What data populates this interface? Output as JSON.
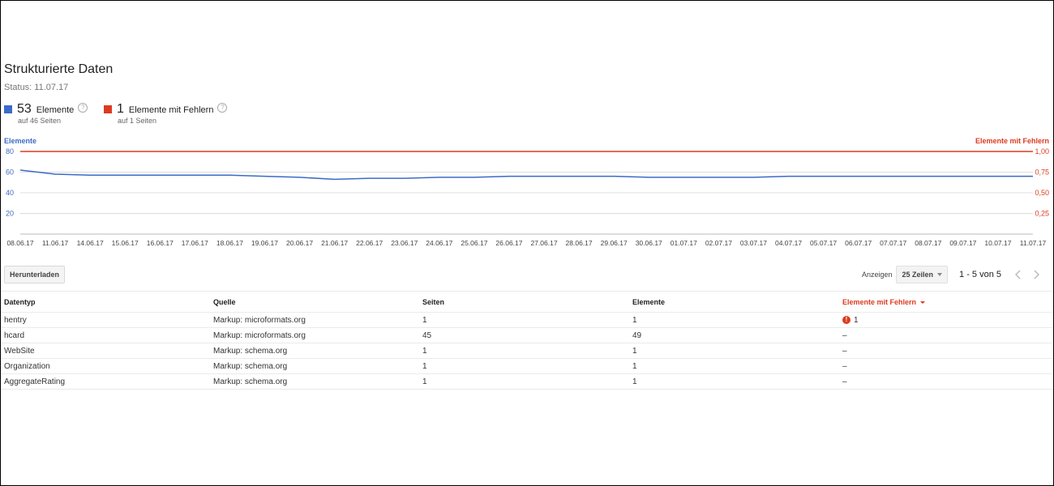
{
  "page": {
    "title": "Strukturierte Daten",
    "status": "Status: 11.07.17"
  },
  "summary": {
    "items": {
      "count": "53",
      "label": "Elemente",
      "sub": "auf 46 Seiten",
      "color": "#3c6bc8"
    },
    "errors": {
      "count": "1",
      "label": "Elemente mit Fehlern",
      "sub": "auf 1 Seiten",
      "color": "#dd3b1f"
    },
    "help_icon": "help-circle-icon"
  },
  "chart_data": {
    "type": "line",
    "x": [
      "08.06.17",
      "11.06.17",
      "14.06.17",
      "15.06.17",
      "16.06.17",
      "17.06.17",
      "18.06.17",
      "19.06.17",
      "20.06.17",
      "21.06.17",
      "22.06.17",
      "23.06.17",
      "24.06.17",
      "25.06.17",
      "26.06.17",
      "27.06.17",
      "28.06.17",
      "29.06.17",
      "30.06.17",
      "01.07.17",
      "02.07.17",
      "03.07.17",
      "04.07.17",
      "05.07.17",
      "06.07.17",
      "07.07.17",
      "08.07.17",
      "09.07.17",
      "10.07.17",
      "11.07.17"
    ],
    "series": [
      {
        "name": "Elemente",
        "axis": "left",
        "color": "#3c6bc8",
        "values": [
          62,
          58,
          57,
          57,
          57,
          57,
          57,
          56,
          55,
          53,
          54,
          54,
          55,
          55,
          56,
          56,
          56,
          56,
          55,
          55,
          55,
          55,
          56,
          56,
          56,
          56,
          56,
          56,
          56,
          56
        ]
      },
      {
        "name": "Elemente mit Fehlern",
        "axis": "right",
        "color": "#dd3b1f",
        "values": [
          1,
          1,
          1,
          1,
          1,
          1,
          1,
          1,
          1,
          1,
          1,
          1,
          1,
          1,
          1,
          1,
          1,
          1,
          1,
          1,
          1,
          1,
          1,
          1,
          1,
          1,
          1,
          1,
          1,
          1
        ]
      }
    ],
    "ylabel": "Elemente",
    "ylabel_right": "Elemente mit Fehlern",
    "yticks_left": [
      "80",
      "60",
      "40",
      "20"
    ],
    "yticks_right": [
      "1,00",
      "0,75",
      "0,50",
      "0,25"
    ],
    "ylim": [
      0,
      80
    ],
    "ylim_right": [
      0,
      1
    ],
    "grid": true
  },
  "toolbar": {
    "download_label": "Herunterladen",
    "show_label": "Anzeigen",
    "rows_value": "25 Zeilen",
    "range": "1 - 5 von 5"
  },
  "table": {
    "headers": [
      "Datentyp",
      "Quelle",
      "Seiten",
      "Elemente",
      "Elemente mit Fehlern"
    ],
    "rows": [
      [
        "hentry",
        "Markup: microformats.org",
        "1",
        "1",
        "1"
      ],
      [
        "hcard",
        "Markup: microformats.org",
        "45",
        "49",
        "–"
      ],
      [
        "WebSite",
        "Markup: schema.org",
        "1",
        "1",
        "–"
      ],
      [
        "Organization",
        "Markup: schema.org",
        "1",
        "1",
        "–"
      ],
      [
        "AggregateRating",
        "Markup: schema.org",
        "1",
        "1",
        "–"
      ]
    ]
  }
}
